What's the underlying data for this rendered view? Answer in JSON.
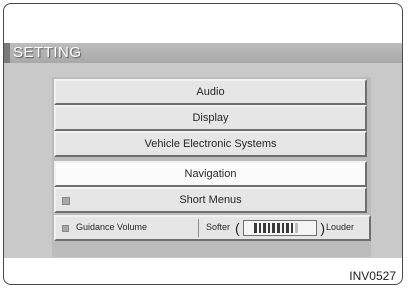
{
  "header": {
    "title": "SETTING"
  },
  "menu": {
    "items": [
      {
        "label": "Audio",
        "selected": false
      },
      {
        "label": "Display",
        "selected": false
      },
      {
        "label": "Vehicle Electronic Systems",
        "selected": false
      },
      {
        "label": "Navigation",
        "selected": true
      },
      {
        "label": "Short Menus",
        "selected": false
      }
    ],
    "guidance_volume": {
      "label": "Guidance Volume",
      "softer_label": "Softer",
      "louder_label": "Louder",
      "level_fraction": 0.85
    }
  },
  "caption": "INV0527"
}
